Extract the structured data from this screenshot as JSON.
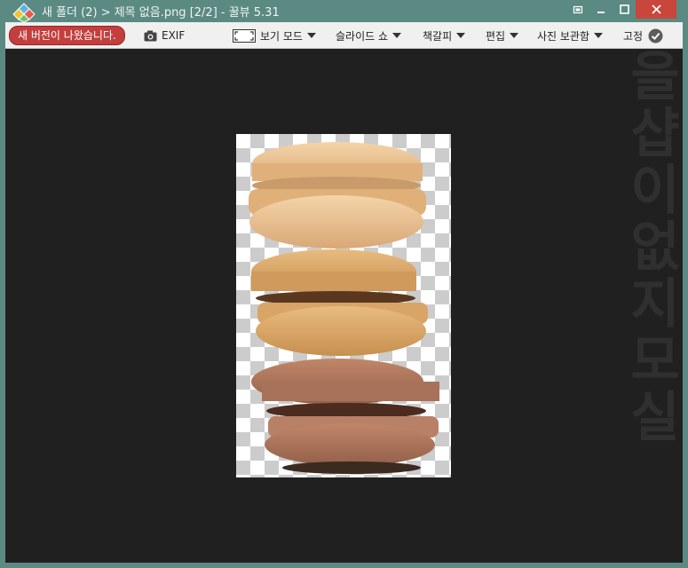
{
  "titlebar": {
    "title": "새 폴더 (2) > 제목 없음.png [2/2] - 꿀뷰 5.31"
  },
  "toolbar": {
    "new_version": "새 버전이 나왔습니다.",
    "exif": "EXIF",
    "view_mode": "보기 모드",
    "slideshow": "슬라이드 쇼",
    "bookmark": "책갈피",
    "edit": "편집",
    "photo_archive": "사진 보관함",
    "fix": "고정"
  },
  "watermark": [
    "을",
    "샵",
    "이",
    "없",
    "지",
    "모",
    "실"
  ],
  "colors": {
    "titlebar": "#5b8a83",
    "close": "#c9463d",
    "toolbar": "#f0f0f0",
    "accent_red": "#c43e3e",
    "canvas": "#202020"
  },
  "icons": {
    "app": "honeyview-diamond-icon",
    "exif": "camera-icon",
    "view_mode": "fit-screen-icon",
    "fix": "check-circle-icon"
  }
}
